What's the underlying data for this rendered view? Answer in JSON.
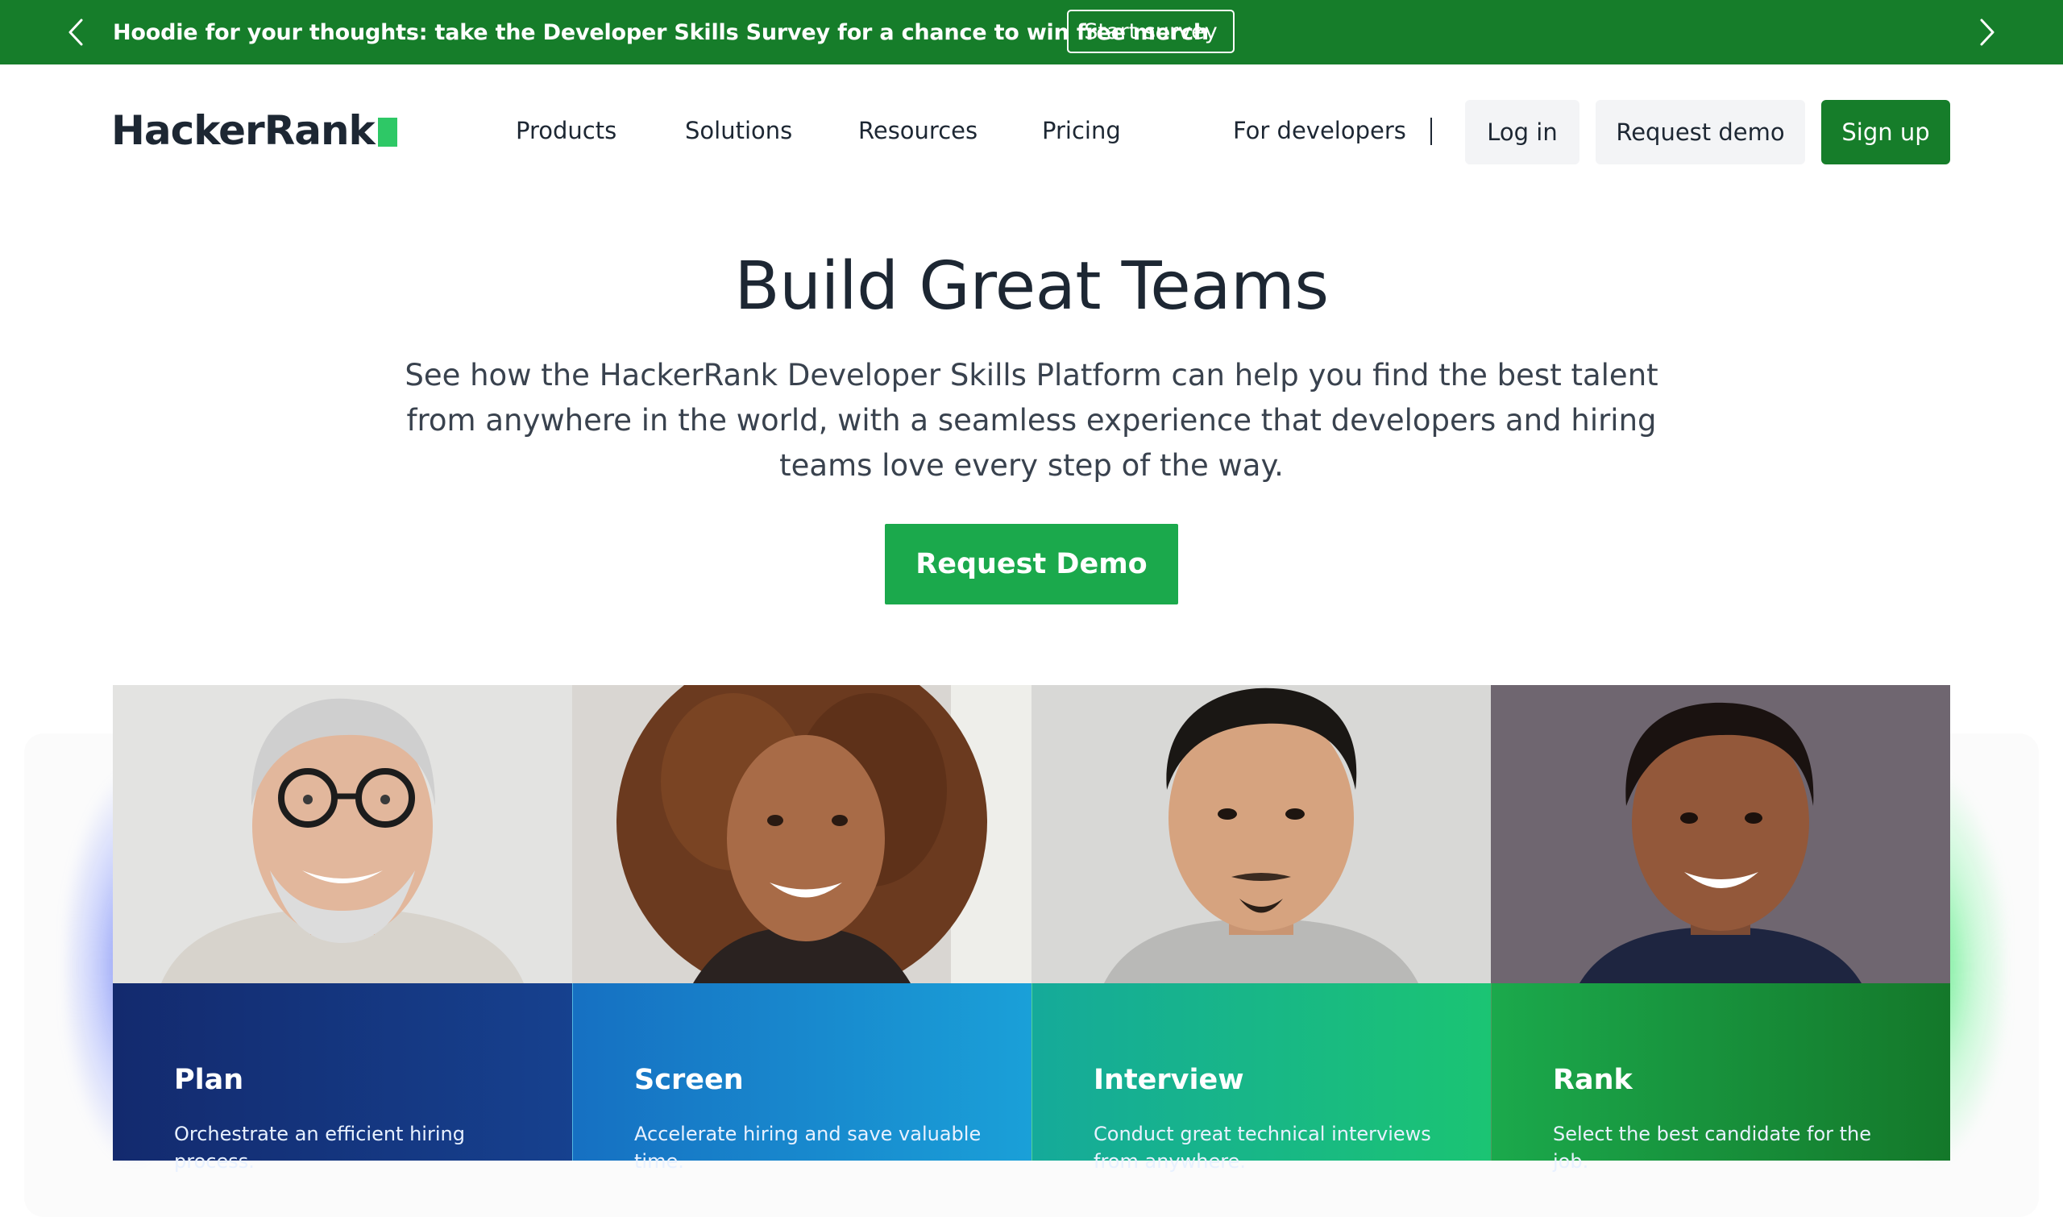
{
  "announcement": {
    "message": "Hoodie for your thoughts: take the Developer Skills Survey for a chance to win free merch",
    "cta_label": "Start survey"
  },
  "header": {
    "logo_text": "HackerRank",
    "nav": [
      "Products",
      "Solutions",
      "Resources",
      "Pricing"
    ],
    "for_developers": "For developers",
    "login_label": "Log in",
    "request_demo_label": "Request demo",
    "signup_label": "Sign up"
  },
  "hero": {
    "title": "Build Great Teams",
    "subtitle": "See how the HackerRank Developer Skills Platform can help you find the best talent from anywhere in the world, with a seamless experience that developers and hiring teams love every step of the way.",
    "cta_label": "Request Demo"
  },
  "cards": [
    {
      "title": "Plan",
      "description": "Orchestrate an efficient hiring process."
    },
    {
      "title": "Screen",
      "description": "Accelerate hiring and save valuable time."
    },
    {
      "title": "Interview",
      "description": "Conduct great technical interviews from anywhere."
    },
    {
      "title": "Rank",
      "description": "Select the best candidate for the job."
    }
  ],
  "colors": {
    "brand_green": "#167d2a",
    "cta_green": "#1ba94c",
    "logo_green": "#2ec866",
    "card_plan": "#15307a",
    "card_screen": "#1a8fd1",
    "card_interview": "#1bbf7a",
    "card_rank": "#1a8a2f"
  },
  "icons": {
    "prev": "chevron-left-icon",
    "next": "chevron-right-icon"
  }
}
